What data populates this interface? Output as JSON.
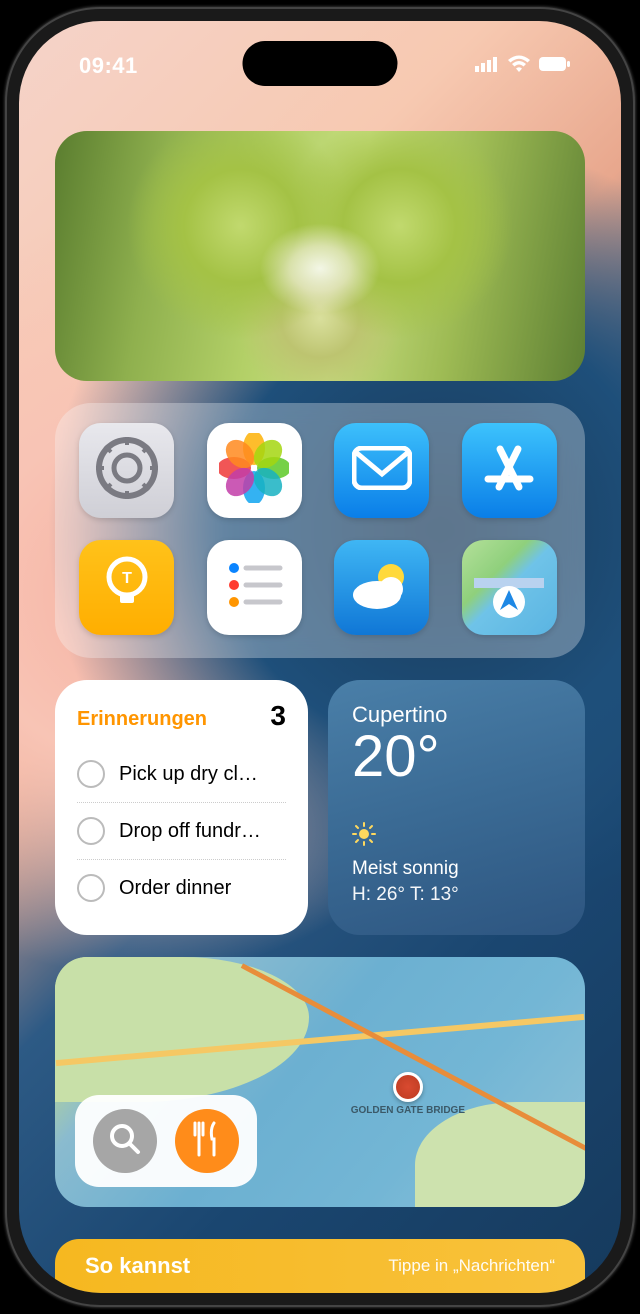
{
  "status": {
    "time": "09:41"
  },
  "apps": [
    {
      "name": "settings"
    },
    {
      "name": "photos"
    },
    {
      "name": "mail"
    },
    {
      "name": "appstore"
    },
    {
      "name": "tips"
    },
    {
      "name": "reminders"
    },
    {
      "name": "weather"
    },
    {
      "name": "maps"
    }
  ],
  "reminders": {
    "title": "Erinnerungen",
    "count": "3",
    "items": [
      "Pick up dry cl…",
      "Drop off fundr…",
      "Order dinner"
    ]
  },
  "weather": {
    "location": "Cupertino",
    "temp": "20°",
    "condition": "Meist sonnig",
    "high_low": "H: 26° T: 13°"
  },
  "maps": {
    "poi": "GOLDEN GATE BRIDGE"
  },
  "banner": {
    "title": "So kannst",
    "subtitle": "Tippe in „Nachrichten“"
  }
}
